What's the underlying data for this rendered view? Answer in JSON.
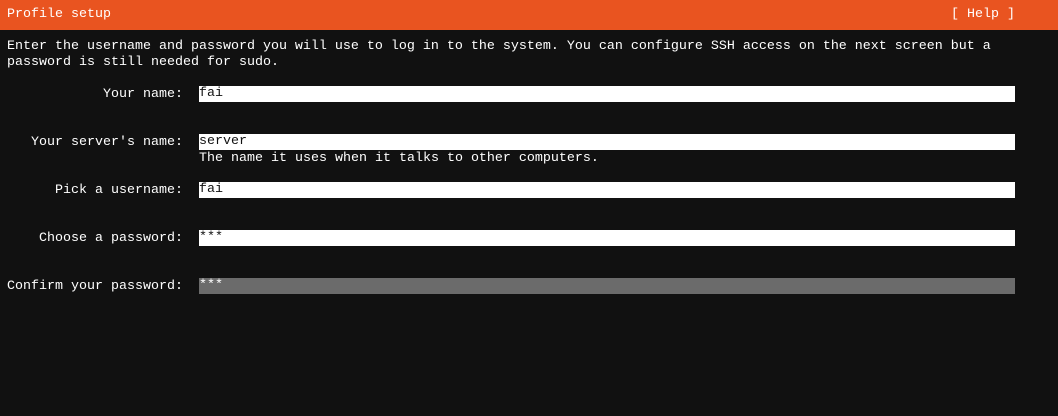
{
  "header": {
    "title": "Profile setup",
    "help_label": "[ Help ]"
  },
  "intro": {
    "line1": "Enter the username and password you will use to log in to the system. You can configure SSH access on the next screen but a",
    "line2": "password is still needed for sudo."
  },
  "form": {
    "name": {
      "label": "Your name:",
      "value": "fai"
    },
    "server": {
      "label": "Your server's name:",
      "value": "server",
      "hint": "The name it uses when it talks to other computers."
    },
    "username": {
      "label": "Pick a username:",
      "value": "fai"
    },
    "password": {
      "label": "Choose a password:",
      "value": "***"
    },
    "confirm": {
      "label": "Confirm your password:",
      "value": "***"
    }
  },
  "colors": {
    "accent": "#e95420",
    "background": "#111111",
    "focused_field": "#6b6b6b"
  }
}
